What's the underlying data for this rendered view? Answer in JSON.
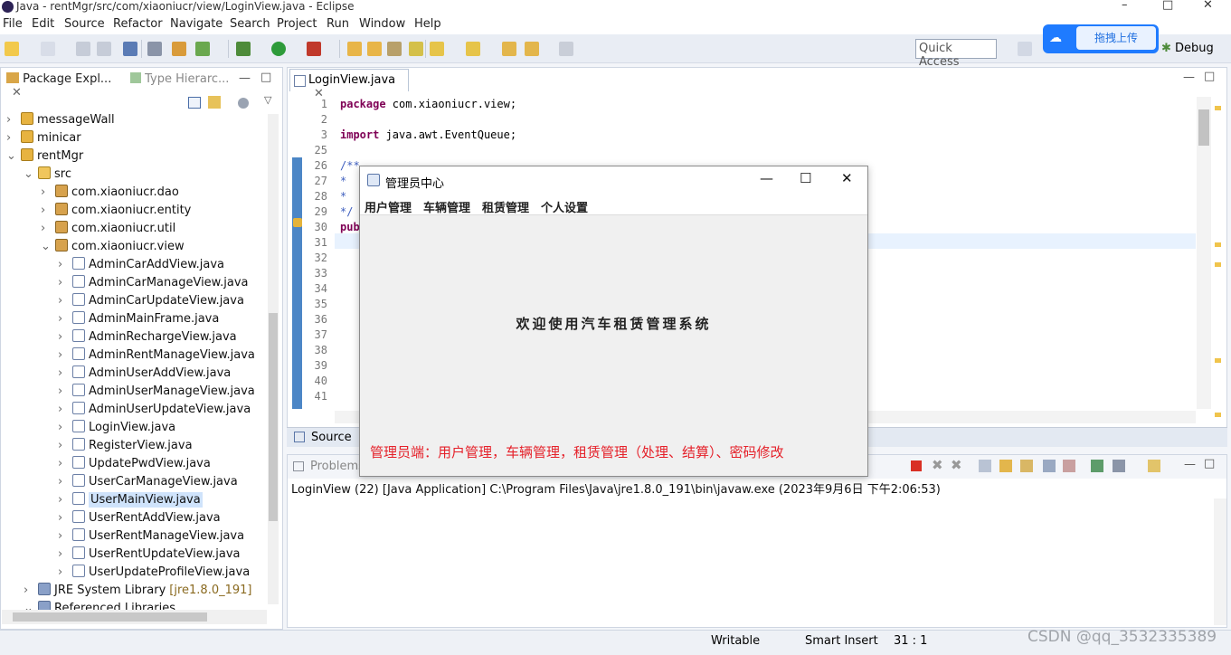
{
  "window": {
    "title": "Java - rentMgr/src/com/xiaoniucr/view/LoginView.java - Eclipse",
    "controls": [
      "–",
      "□",
      "✕"
    ]
  },
  "menu": [
    "File",
    "Edit",
    "Source",
    "Refactor",
    "Navigate",
    "Search",
    "Project",
    "Run",
    "Window",
    "Help"
  ],
  "quick_access": {
    "placeholder": "Quick Access"
  },
  "upload_widget": {
    "label": "拖拽上传"
  },
  "perspectives": {
    "debug": "Debug"
  },
  "left_panel": {
    "tabs": [
      "Package Expl...",
      "Type Hierarc..."
    ],
    "tree": [
      {
        "label": "messageWall",
        "type": "project",
        "depth": 0,
        "twisty": ">"
      },
      {
        "label": "minicar",
        "type": "project",
        "depth": 0,
        "twisty": ">"
      },
      {
        "label": "rentMgr",
        "type": "project",
        "depth": 0,
        "twisty": "v"
      },
      {
        "label": "src",
        "type": "folder",
        "depth": 1,
        "twisty": "v"
      },
      {
        "label": "com.xiaoniucr.dao",
        "type": "package",
        "depth": 2,
        "twisty": ">"
      },
      {
        "label": "com.xiaoniucr.entity",
        "type": "package",
        "depth": 2,
        "twisty": ">"
      },
      {
        "label": "com.xiaoniucr.util",
        "type": "package",
        "depth": 2,
        "twisty": ">"
      },
      {
        "label": "com.xiaoniucr.view",
        "type": "package",
        "depth": 2,
        "twisty": "v"
      },
      {
        "label": "AdminCarAddView.java",
        "type": "java",
        "depth": 3,
        "twisty": ">"
      },
      {
        "label": "AdminCarManageView.java",
        "type": "java",
        "depth": 3,
        "twisty": ">"
      },
      {
        "label": "AdminCarUpdateView.java",
        "type": "java",
        "depth": 3,
        "twisty": ">"
      },
      {
        "label": "AdminMainFrame.java",
        "type": "java",
        "depth": 3,
        "twisty": ">"
      },
      {
        "label": "AdminRechargeView.java",
        "type": "java",
        "depth": 3,
        "twisty": ">"
      },
      {
        "label": "AdminRentManageView.java",
        "type": "java",
        "depth": 3,
        "twisty": ">"
      },
      {
        "label": "AdminUserAddView.java",
        "type": "java",
        "depth": 3,
        "twisty": ">"
      },
      {
        "label": "AdminUserManageView.java",
        "type": "java",
        "depth": 3,
        "twisty": ">"
      },
      {
        "label": "AdminUserUpdateView.java",
        "type": "java",
        "depth": 3,
        "twisty": ">"
      },
      {
        "label": "LoginView.java",
        "type": "java",
        "depth": 3,
        "twisty": ">"
      },
      {
        "label": "RegisterView.java",
        "type": "java",
        "depth": 3,
        "twisty": ">"
      },
      {
        "label": "UpdatePwdView.java",
        "type": "java",
        "depth": 3,
        "twisty": ">"
      },
      {
        "label": "UserCarManageView.java",
        "type": "java",
        "depth": 3,
        "twisty": ">"
      },
      {
        "label": "UserMainView.java",
        "type": "java",
        "depth": 3,
        "twisty": ">",
        "selected": true
      },
      {
        "label": "UserRentAddView.java",
        "type": "java",
        "depth": 3,
        "twisty": ">"
      },
      {
        "label": "UserRentManageView.java",
        "type": "java",
        "depth": 3,
        "twisty": ">"
      },
      {
        "label": "UserRentUpdateView.java",
        "type": "java",
        "depth": 3,
        "twisty": ">"
      },
      {
        "label": "UserUpdateProfileView.java",
        "type": "java",
        "depth": 3,
        "twisty": ">"
      },
      {
        "label": "JRE System Library",
        "suffix": "[jre1.8.0_191]",
        "type": "library",
        "depth": 1,
        "twisty": ">"
      },
      {
        "label": "Referenced Libraries",
        "type": "library",
        "depth": 1,
        "twisty": "v"
      }
    ]
  },
  "editor": {
    "tab": "LoginView.java",
    "lines": [
      {
        "n": "1",
        "code": "package com.xiaoniucr.view;"
      },
      {
        "n": "2",
        "code": ""
      },
      {
        "n": "3",
        "code": "import java.awt.EventQueue;"
      },
      {
        "n": "25",
        "code": ""
      },
      {
        "n": "26",
        "code": "/**"
      },
      {
        "n": "27",
        "code": " *"
      },
      {
        "n": "28",
        "code": " *"
      },
      {
        "n": "29",
        "code": " */"
      },
      {
        "n": "30",
        "code": "publ"
      },
      {
        "n": "31",
        "code": ""
      },
      {
        "n": "32",
        "code": ""
      },
      {
        "n": "33",
        "code": ""
      },
      {
        "n": "34",
        "code": ""
      },
      {
        "n": "35",
        "code": ""
      },
      {
        "n": "36",
        "code": ""
      },
      {
        "n": "37",
        "code": ""
      },
      {
        "n": "38",
        "code": ""
      },
      {
        "n": "39",
        "code": ""
      },
      {
        "n": "40",
        "code": ""
      },
      {
        "n": "41",
        "code": ""
      }
    ],
    "bottom_tab": "Source"
  },
  "console": {
    "tab": "Problems",
    "line": "LoginView (22) [Java Application] C:\\Program Files\\Java\\jre1.8.0_191\\bin\\javaw.exe (2023年9月6日 下午2:06:53)"
  },
  "status": {
    "mode": "Writable",
    "insert": "Smart Insert",
    "position": "31 : 1"
  },
  "watermark": "CSDN @qq_3532335389",
  "dialog": {
    "title": "管理员中心",
    "menu": [
      "用户管理",
      "车辆管理",
      "租赁管理",
      "个人设置"
    ],
    "welcome": "欢迎使用汽车租赁管理系统",
    "note": "管理员端：用户管理，车辆管理，租赁管理（处理、结算）、密码修改",
    "note_color": "#e5212a"
  }
}
